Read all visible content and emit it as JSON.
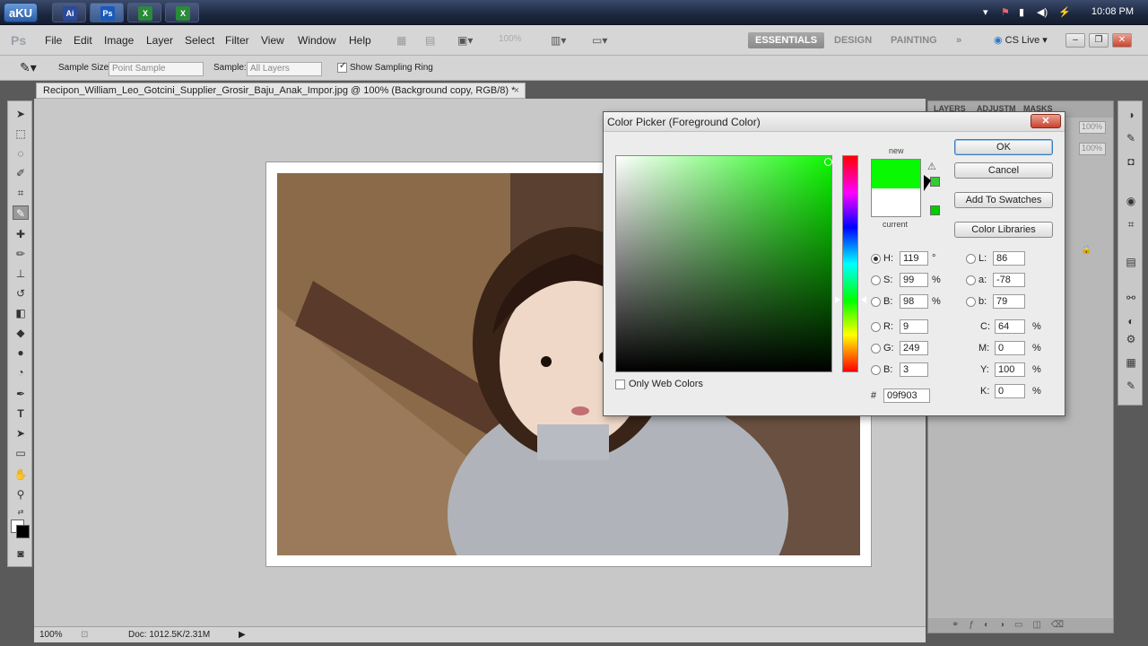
{
  "taskbar": {
    "start_label": "aKU",
    "apps": [
      {
        "icon": "aftereffects-icon",
        "label": "Ai"
      },
      {
        "icon": "photoshop-icon",
        "label": "Ps"
      },
      {
        "icon": "excel-icon",
        "label": "X"
      },
      {
        "icon": "excel-icon-2",
        "label": "X"
      }
    ],
    "clock": "10:08 PM"
  },
  "appbar": {
    "logo": "Ps",
    "menu": [
      "File",
      "Edit",
      "Image",
      "Layer",
      "Select",
      "Filter",
      "View",
      "Window",
      "Help"
    ],
    "zoom": "100%",
    "workspaces": [
      "ESSENTIALS",
      "DESIGN",
      "PAINTING"
    ],
    "more": "»",
    "cs_live": "CS Live"
  },
  "options": {
    "sample_size_label": "Sample Size:",
    "sample_size_value": "Point Sample",
    "sample_label": "Sample:",
    "sample_value": "All Layers",
    "show_ring_label": "Show Sampling Ring"
  },
  "document": {
    "tab_title": "Recipon_William_Leo_Gotcini_Supplier_Grosir_Baju_Anak_Impor.jpg @ 100% (Background copy, RGB/8) *",
    "close": "×"
  },
  "status": {
    "zoom": "100%",
    "doc_info": "Doc: 1012.5K/2.31M"
  },
  "panels": {
    "tabs": [
      "LAYERS",
      "ADJUSTM",
      "MASKS"
    ],
    "opacity": "100%",
    "fill": "100%"
  },
  "color_picker": {
    "title": "Color Picker (Foreground Color)",
    "close": "✕",
    "new_label": "new",
    "current_label": "current",
    "new_color": "#09f903",
    "current_color": "#ffffff",
    "buttons": {
      "ok": "OK",
      "cancel": "Cancel",
      "add_swatches": "Add To Swatches",
      "libraries": "Color Libraries"
    },
    "hsb": {
      "h_label": "H:",
      "h": "119",
      "h_unit": "°",
      "s_label": "S:",
      "s": "99",
      "s_unit": "%",
      "b_label": "B:",
      "b": "98",
      "b_unit": "%"
    },
    "rgb": {
      "r_label": "R:",
      "r": "9",
      "g_label": "G:",
      "g": "249",
      "b_label": "B:",
      "b": "3"
    },
    "lab": {
      "l_label": "L:",
      "l": "86",
      "a_label": "a:",
      "a": "-78",
      "b_label": "b:",
      "b": "79"
    },
    "cmyk": {
      "c_label": "C:",
      "c": "64",
      "c_unit": "%",
      "m_label": "M:",
      "m": "0",
      "m_unit": "%",
      "y_label": "Y:",
      "y": "100",
      "y_unit": "%",
      "k_label": "K:",
      "k": "0",
      "k_unit": "%"
    },
    "hex_label": "#",
    "hex": "09f903",
    "web_colors_label": "Only Web Colors"
  }
}
